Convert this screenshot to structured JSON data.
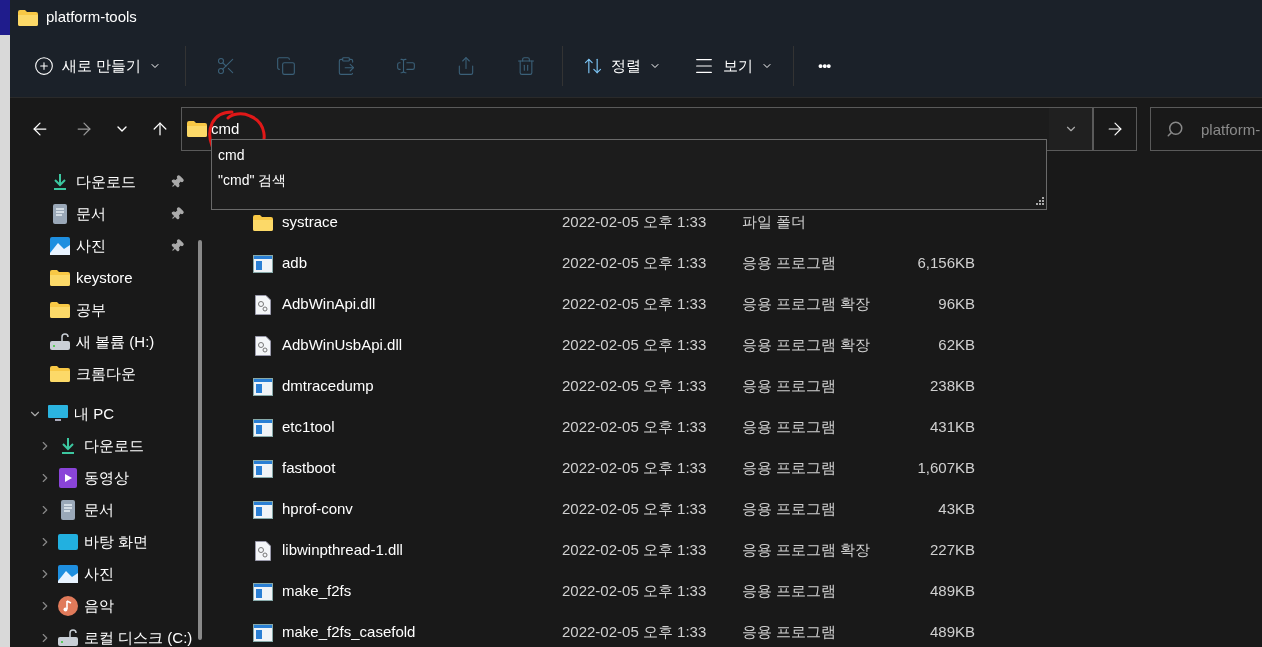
{
  "window": {
    "title": "platform-tools"
  },
  "toolbar": {
    "new_button": "새로 만들기",
    "sort_button": "정렬",
    "view_button": "보기",
    "more_button": "•••"
  },
  "address_bar": {
    "value": "cmd",
    "suggestions": [
      "cmd",
      "\"cmd\" 검색"
    ]
  },
  "search": {
    "placeholder": "platform-"
  },
  "sidebar": {
    "quick_access": [
      {
        "label": "다운로드",
        "kind": "download",
        "pinned": true
      },
      {
        "label": "문서",
        "kind": "document",
        "pinned": true
      },
      {
        "label": "사진",
        "kind": "picture",
        "pinned": true
      },
      {
        "label": "keystore",
        "kind": "folder",
        "pinned": false
      },
      {
        "label": "공부",
        "kind": "folder",
        "pinned": false
      },
      {
        "label": "새 볼륨 (H:)",
        "kind": "drive",
        "pinned": false
      },
      {
        "label": "크롬다운",
        "kind": "folder",
        "pinned": false
      }
    ],
    "tree": [
      {
        "label": "내 PC",
        "kind": "pc",
        "expanded": true,
        "children": [
          {
            "label": "다운로드",
            "kind": "download",
            "expanded": false
          },
          {
            "label": "동영상",
            "kind": "video",
            "expanded": false
          },
          {
            "label": "문서",
            "kind": "document",
            "expanded": false
          },
          {
            "label": "바탕 화면",
            "kind": "desktop",
            "expanded": false
          },
          {
            "label": "사진",
            "kind": "picture",
            "expanded": false
          },
          {
            "label": "음악",
            "kind": "music",
            "expanded": false
          },
          {
            "label": "로컬 디스크 (C:)",
            "kind": "drive",
            "expanded": false
          }
        ]
      }
    ]
  },
  "files": [
    {
      "name": "systrace",
      "kind": "folder",
      "modified": "2022-02-05 오후 1:33",
      "type": "파일 폴더"
    },
    {
      "name": "adb",
      "kind": "exe",
      "modified": "2022-02-05 오후 1:33",
      "type": "응용 프로그램",
      "size": "6,156KB"
    },
    {
      "name": "AdbWinApi.dll",
      "kind": "dll",
      "modified": "2022-02-05 오후 1:33",
      "type": "응용 프로그램 확장",
      "size": "96KB"
    },
    {
      "name": "AdbWinUsbApi.dll",
      "kind": "dll",
      "modified": "2022-02-05 오후 1:33",
      "type": "응용 프로그램 확장",
      "size": "62KB"
    },
    {
      "name": "dmtracedump",
      "kind": "exe",
      "modified": "2022-02-05 오후 1:33",
      "type": "응용 프로그램",
      "size": "238KB"
    },
    {
      "name": "etc1tool",
      "kind": "exe",
      "modified": "2022-02-05 오후 1:33",
      "type": "응용 프로그램",
      "size": "431KB"
    },
    {
      "name": "fastboot",
      "kind": "exe",
      "modified": "2022-02-05 오후 1:33",
      "type": "응용 프로그램",
      "size": "1,607KB"
    },
    {
      "name": "hprof-conv",
      "kind": "exe",
      "modified": "2022-02-05 오후 1:33",
      "type": "응용 프로그램",
      "size": "43KB"
    },
    {
      "name": "libwinpthread-1.dll",
      "kind": "dll",
      "modified": "2022-02-05 오후 1:33",
      "type": "응용 프로그램 확장",
      "size": "227KB"
    },
    {
      "name": "make_f2fs",
      "kind": "exe",
      "modified": "2022-02-05 오후 1:33",
      "type": "응용 프로그램",
      "size": "489KB"
    },
    {
      "name": "make_f2fs_casefold",
      "kind": "exe",
      "modified": "2022-02-05 오후 1:33",
      "type": "응용 프로그램",
      "size": "489KB"
    }
  ]
}
